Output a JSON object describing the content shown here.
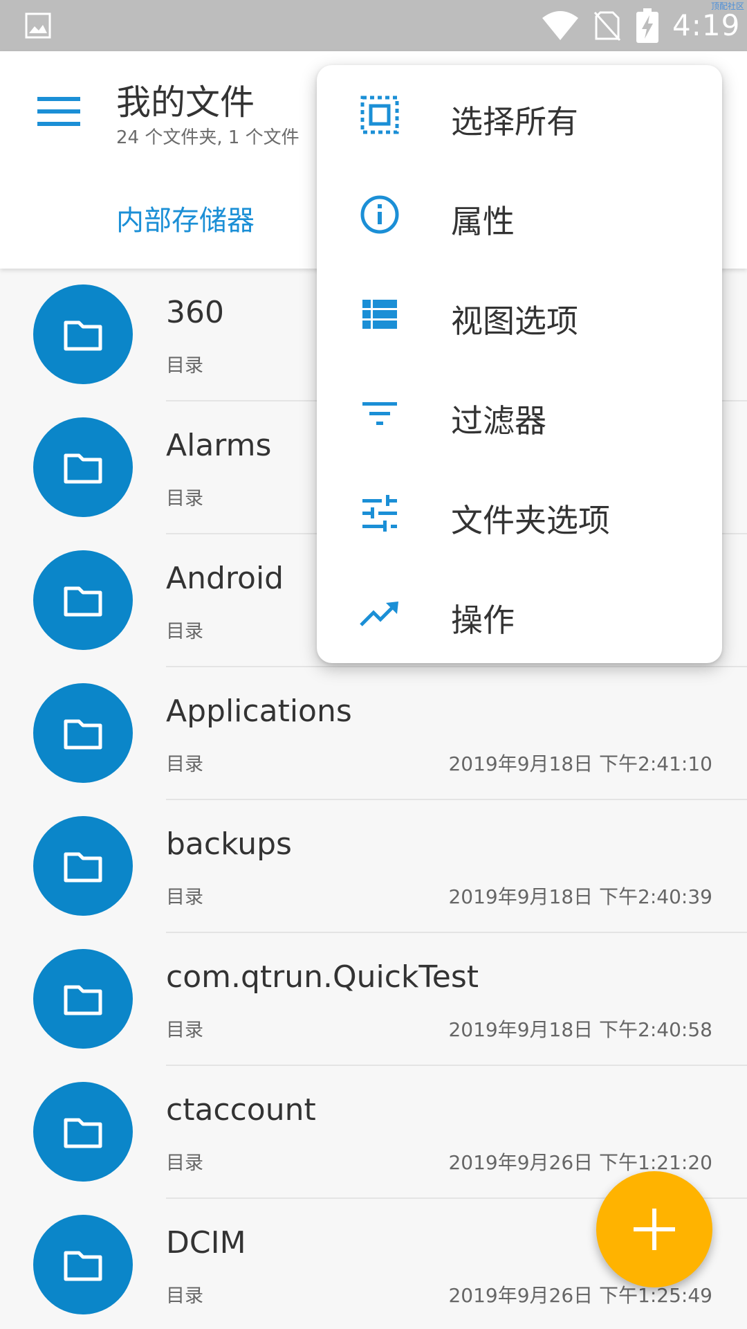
{
  "status_bar": {
    "time": "4:19",
    "watermark": "顶配社区",
    "icons": [
      "gallery-icon",
      "wifi-icon",
      "no-sim-icon",
      "battery-charging-icon"
    ]
  },
  "app_bar": {
    "title": "我的文件",
    "subtitle": "24 个文件夹, 1 个文件",
    "tab": "内部存储器",
    "menu_icon": "menu-icon"
  },
  "files": [
    {
      "name": "360",
      "type": "目录",
      "date": ""
    },
    {
      "name": "Alarms",
      "type": "目录",
      "date": ""
    },
    {
      "name": "Android",
      "type": "目录",
      "date": ""
    },
    {
      "name": "Applications",
      "type": "目录",
      "date": "2019年9月18日 下午2:41:10"
    },
    {
      "name": "backups",
      "type": "目录",
      "date": "2019年9月18日 下午2:40:39"
    },
    {
      "name": "com.qtrun.QuickTest",
      "type": "目录",
      "date": "2019年9月18日 下午2:40:58"
    },
    {
      "name": "ctaccount",
      "type": "目录",
      "date": "2019年9月26日 下午1:21:20"
    },
    {
      "name": "DCIM",
      "type": "目录",
      "date": "2019年9月26日 下午1:25:49"
    }
  ],
  "overflow_menu": {
    "items": [
      {
        "label": "选择所有",
        "icon": "select-all-icon"
      },
      {
        "label": "属性",
        "icon": "info-icon"
      },
      {
        "label": "视图选项",
        "icon": "view-list-icon"
      },
      {
        "label": "过滤器",
        "icon": "filter-icon"
      },
      {
        "label": "文件夹选项",
        "icon": "tune-icon"
      },
      {
        "label": "操作",
        "icon": "trending-up-icon"
      }
    ]
  },
  "fab": {
    "icon": "plus-icon"
  },
  "colors": {
    "accent": "#1b8fd6",
    "folder": "#0b86c9",
    "fab": "#ffb300",
    "status_bar": "#bdbdbd"
  }
}
